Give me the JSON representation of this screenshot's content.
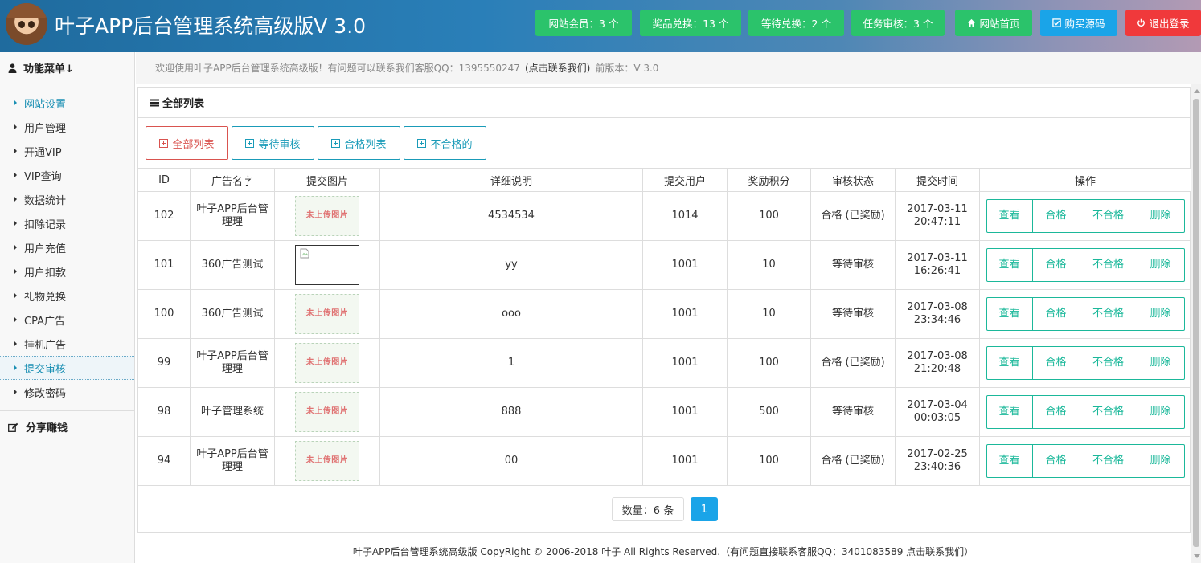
{
  "header": {
    "title": "叶子APP后台管理系统高级版V 3.0",
    "stats": [
      {
        "label": "网站会员：",
        "value": "3 个"
      },
      {
        "label": "奖品兑换：",
        "value": "13 个"
      },
      {
        "label": "等待兑换：",
        "value": "2 个"
      },
      {
        "label": "任务审核：",
        "value": "3 个"
      }
    ],
    "home_label": "网站首页",
    "buy_label": "购买源码",
    "logout_label": "退出登录",
    "colors": {
      "green": "#2bc36b",
      "blue": "#1aa4e8",
      "red": "#f0393b"
    }
  },
  "sidebar": {
    "menu_title": "功能菜单↓",
    "items": [
      {
        "label": "网站设置"
      },
      {
        "label": "用户管理"
      },
      {
        "label": "开通VIP"
      },
      {
        "label": "VIP查询"
      },
      {
        "label": "数据统计"
      },
      {
        "label": "扣除记录"
      },
      {
        "label": "用户充值"
      },
      {
        "label": "用户扣款"
      },
      {
        "label": "礼物兑换"
      },
      {
        "label": "CPA广告"
      },
      {
        "label": "挂机广告"
      },
      {
        "label": "提交审核"
      },
      {
        "label": "修改密码"
      }
    ],
    "share_label": "分享赚钱"
  },
  "welcome": {
    "text": "欢迎使用叶子APP后台管理系统高级版！有问题可以联系我们客服QQ：1395550247",
    "contact_link": "(点击联系我们)",
    "version": "前版本：V 3.0"
  },
  "panel": {
    "title": "全部列表",
    "filters": [
      "全部列表",
      "等待审核",
      "合格列表",
      "不合格的"
    ]
  },
  "table": {
    "columns": [
      "ID",
      "广告名字",
      "提交图片",
      "详细说明",
      "提交用户",
      "奖励积分",
      "审核状态",
      "提交时间",
      "操作"
    ],
    "placeholder_image_text": "未上传图片",
    "rows": [
      {
        "id": "102",
        "name": "叶子APP后台管理理",
        "image": "placeholder",
        "desc": "4534534",
        "user": "1014",
        "points": "100",
        "status": "合格 (已奖励)",
        "status_type": "ok",
        "date": "2017-03-11",
        "time": "20:47:11"
      },
      {
        "id": "101",
        "name": "360广告测试",
        "image": "broken",
        "desc": "yy",
        "user": "1001",
        "points": "10",
        "status": "等待审核",
        "status_type": "wait",
        "date": "2017-03-11",
        "time": "16:26:41"
      },
      {
        "id": "100",
        "name": "360广告测试",
        "image": "placeholder",
        "desc": "ooo",
        "user": "1001",
        "points": "10",
        "status": "等待审核",
        "status_type": "wait",
        "date": "2017-03-08",
        "time": "23:34:46"
      },
      {
        "id": "99",
        "name": "叶子APP后台管理理",
        "image": "placeholder",
        "desc": "1",
        "user": "1001",
        "points": "100",
        "status": "合格 (已奖励)",
        "status_type": "ok",
        "date": "2017-03-08",
        "time": "21:20:48"
      },
      {
        "id": "98",
        "name": "叶子管理系统",
        "image": "placeholder",
        "desc": "888",
        "user": "1001",
        "points": "500",
        "status": "等待审核",
        "status_type": "wait",
        "date": "2017-03-04",
        "time": "00:03:05"
      },
      {
        "id": "94",
        "name": "叶子APP后台管理理",
        "image": "placeholder",
        "desc": "00",
        "user": "1001",
        "points": "100",
        "status": "合格 (已奖励)",
        "status_type": "ok",
        "date": "2017-02-25",
        "time": "23:40:36"
      }
    ],
    "actions": [
      "查看",
      "合格",
      "不合格",
      "删除"
    ]
  },
  "pager": {
    "count_label": "数量：6 条",
    "current_page": "1"
  },
  "footer": {
    "text": "叶子APP后台管理系统高级版 CopyRight © 2006-2018 叶子 All Rights Reserved.（有问题直接联系客服QQ：3401083589 点击联系我们）"
  }
}
